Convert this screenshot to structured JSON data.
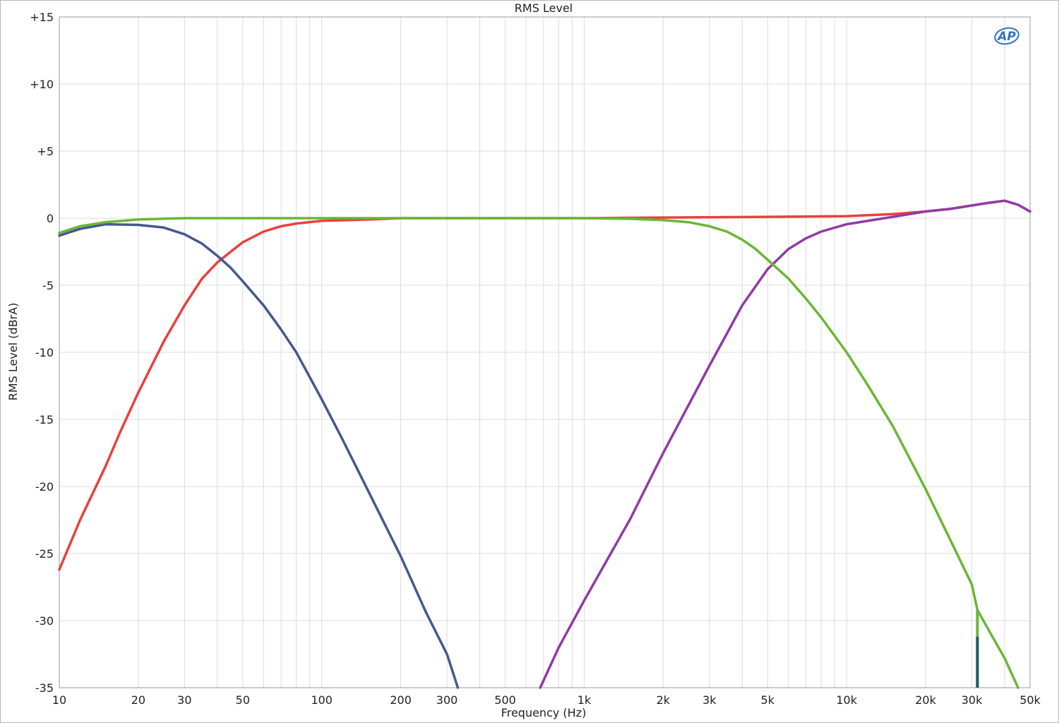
{
  "chart_data": {
    "type": "line",
    "title": "RMS Level",
    "xlabel": "Frequency (Hz)",
    "ylabel": "RMS Level (dBrA)",
    "x_scale": "log",
    "xlim": [
      10,
      50000
    ],
    "ylim": [
      -35,
      15
    ],
    "grid": true,
    "legend": "none",
    "logo_text": "AP",
    "x_ticks": [
      {
        "value": 10,
        "label": "10"
      },
      {
        "value": 20,
        "label": "20"
      },
      {
        "value": 30,
        "label": "30"
      },
      {
        "value": 50,
        "label": "50"
      },
      {
        "value": 100,
        "label": "100"
      },
      {
        "value": 200,
        "label": "200"
      },
      {
        "value": 300,
        "label": "300"
      },
      {
        "value": 500,
        "label": "500"
      },
      {
        "value": 1000,
        "label": "1k"
      },
      {
        "value": 2000,
        "label": "2k"
      },
      {
        "value": 3000,
        "label": "3k"
      },
      {
        "value": 5000,
        "label": "5k"
      },
      {
        "value": 10000,
        "label": "10k"
      },
      {
        "value": 20000,
        "label": "20k"
      },
      {
        "value": 30000,
        "label": "30k"
      },
      {
        "value": 50000,
        "label": "50k"
      }
    ],
    "y_ticks": [
      {
        "value": 15,
        "label": "+15"
      },
      {
        "value": 10,
        "label": "+10"
      },
      {
        "value": 5,
        "label": "+5"
      },
      {
        "value": 0,
        "label": "0"
      },
      {
        "value": -5,
        "label": "-5"
      },
      {
        "value": -10,
        "label": "-10"
      },
      {
        "value": -15,
        "label": "-15"
      },
      {
        "value": -20,
        "label": "-20"
      },
      {
        "value": -25,
        "label": "-25"
      },
      {
        "value": -30,
        "label": "-30"
      },
      {
        "value": -35,
        "label": "-35"
      }
    ],
    "series": [
      {
        "color": "#e8413c",
        "points": [
          [
            10,
            -26.2
          ],
          [
            12,
            -22.5
          ],
          [
            15,
            -18.5
          ],
          [
            17,
            -16
          ],
          [
            20,
            -13
          ],
          [
            25,
            -9.2
          ],
          [
            30,
            -6.5
          ],
          [
            35,
            -4.5
          ],
          [
            40,
            -3.3
          ],
          [
            45,
            -2.5
          ],
          [
            50,
            -1.8
          ],
          [
            60,
            -1.0
          ],
          [
            70,
            -0.6
          ],
          [
            80,
            -0.4
          ],
          [
            100,
            -0.2
          ],
          [
            150,
            -0.1
          ],
          [
            200,
            0
          ],
          [
            500,
            0
          ],
          [
            1000,
            0
          ],
          [
            2000,
            0.05
          ],
          [
            5000,
            0.1
          ],
          [
            10000,
            0.15
          ],
          [
            15000,
            0.3
          ],
          [
            20000,
            0.5
          ],
          [
            25000,
            0.7
          ],
          [
            30000,
            0.95
          ],
          [
            35000,
            1.15
          ],
          [
            40000,
            1.3
          ],
          [
            45000,
            1.0
          ],
          [
            50000,
            0.5
          ]
        ]
      },
      {
        "color": "#45588f",
        "points": [
          [
            10,
            -1.3
          ],
          [
            12,
            -0.8
          ],
          [
            15,
            -0.45
          ],
          [
            20,
            -0.5
          ],
          [
            25,
            -0.7
          ],
          [
            30,
            -1.2
          ],
          [
            35,
            -1.9
          ],
          [
            40,
            -2.8
          ],
          [
            45,
            -3.7
          ],
          [
            50,
            -4.7
          ],
          [
            60,
            -6.5
          ],
          [
            70,
            -8.3
          ],
          [
            80,
            -10
          ],
          [
            100,
            -13.5
          ],
          [
            120,
            -16.5
          ],
          [
            150,
            -20.3
          ],
          [
            200,
            -25.2
          ],
          [
            250,
            -29.4
          ],
          [
            300,
            -32.5
          ],
          [
            330,
            -35
          ]
        ]
      },
      {
        "color": "#903ba6",
        "points": [
          [
            680,
            -35
          ],
          [
            800,
            -32
          ],
          [
            1000,
            -28.5
          ],
          [
            1500,
            -22.4
          ],
          [
            2000,
            -17.5
          ],
          [
            3000,
            -11
          ],
          [
            4000,
            -6.5
          ],
          [
            5000,
            -3.8
          ],
          [
            6000,
            -2.3
          ],
          [
            7000,
            -1.5
          ],
          [
            8000,
            -1.0
          ],
          [
            10000,
            -0.45
          ],
          [
            15000,
            0.1
          ],
          [
            20000,
            0.5
          ],
          [
            25000,
            0.7
          ],
          [
            30000,
            0.95
          ],
          [
            35000,
            1.15
          ],
          [
            40000,
            1.3
          ],
          [
            45000,
            1.0
          ],
          [
            50000,
            0.5
          ]
        ]
      },
      {
        "color": "#6ab636",
        "points": [
          [
            10,
            -1.1
          ],
          [
            12,
            -0.6
          ],
          [
            15,
            -0.3
          ],
          [
            20,
            -0.1
          ],
          [
            30,
            0
          ],
          [
            50,
            0
          ],
          [
            100,
            0
          ],
          [
            500,
            0
          ],
          [
            1000,
            0
          ],
          [
            1500,
            -0.05
          ],
          [
            2000,
            -0.15
          ],
          [
            2500,
            -0.3
          ],
          [
            3000,
            -0.6
          ],
          [
            3500,
            -1.0
          ],
          [
            4000,
            -1.6
          ],
          [
            4500,
            -2.3
          ],
          [
            5000,
            -3.1
          ],
          [
            6000,
            -4.5
          ],
          [
            7000,
            -6
          ],
          [
            8000,
            -7.4
          ],
          [
            10000,
            -10
          ],
          [
            12000,
            -12.4
          ],
          [
            15000,
            -15.5
          ],
          [
            20000,
            -20.2
          ],
          [
            25000,
            -24.1
          ],
          [
            30000,
            -27.3
          ],
          [
            31500,
            -29.2
          ],
          [
            35000,
            -30.8
          ],
          [
            40000,
            -32.8
          ],
          [
            45000,
            -35
          ]
        ]
      }
    ],
    "markers": [
      {
        "x": 31500,
        "y_top": -29.2,
        "y_bottom": -35,
        "color": "#6ab636"
      },
      {
        "x": 31500,
        "y_top": -31.2,
        "y_bottom": -35,
        "color": "#1e5a68"
      }
    ]
  }
}
